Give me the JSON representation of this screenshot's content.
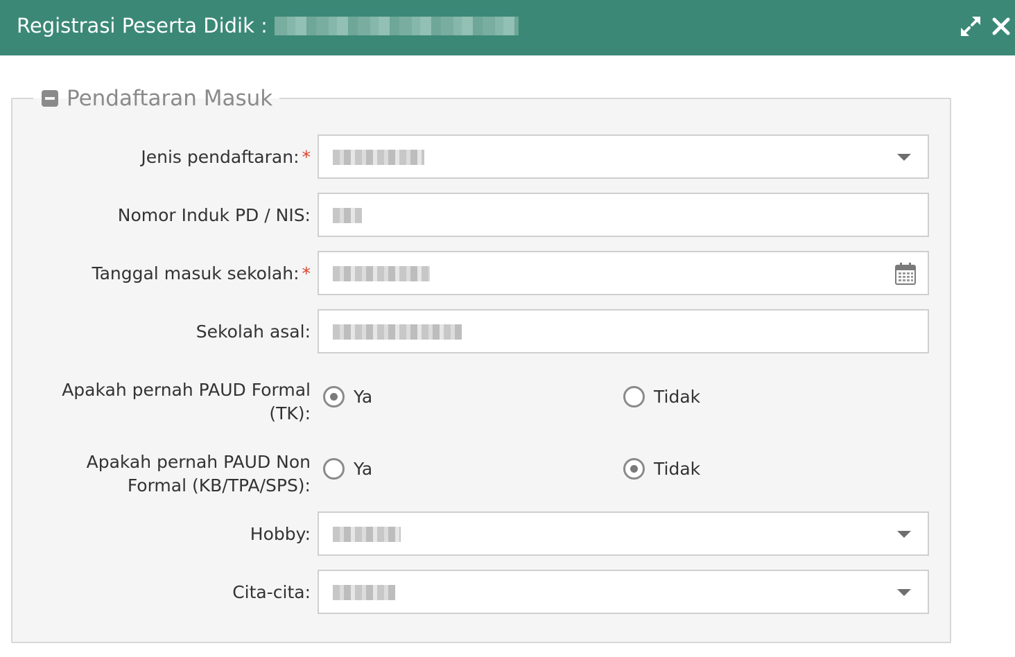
{
  "dialog": {
    "title": "Registrasi Peserta Didik :",
    "expand_icon": "expand-icon",
    "close_icon": "close-icon"
  },
  "section": {
    "legend": "Pendaftaran Masuk",
    "collapse_icon": "minus-square-icon"
  },
  "form": {
    "jenis_pendaftaran": {
      "label": "Jenis pendaftaran:",
      "required_mark": "*",
      "control": "select"
    },
    "nomor_induk": {
      "label": "Nomor Induk PD / NIS:",
      "control": "text"
    },
    "tanggal_masuk": {
      "label": "Tanggal masuk sekolah:",
      "required_mark": "*",
      "control": "date",
      "icon": "calendar-icon"
    },
    "sekolah_asal": {
      "label": "Sekolah asal:",
      "control": "text"
    },
    "paud_formal": {
      "label_line1": "Apakah pernah PAUD Formal",
      "label_line2": "(TK):",
      "options": [
        {
          "label": "Ya",
          "checked": true
        },
        {
          "label": "Tidak",
          "checked": false
        }
      ]
    },
    "paud_nonformal": {
      "label_line1": "Apakah pernah PAUD Non",
      "label_line2": "Formal (KB/TPA/SPS):",
      "options": [
        {
          "label": "Ya",
          "checked": false
        },
        {
          "label": "Tidak",
          "checked": true
        }
      ]
    },
    "hobby": {
      "label": "Hobby:",
      "control": "select"
    },
    "cita_cita": {
      "label": "Cita-cita:",
      "control": "select"
    }
  },
  "colors": {
    "titlebar": "#3b8877",
    "required": "#d9452f",
    "panel": "#f5f5f5"
  }
}
